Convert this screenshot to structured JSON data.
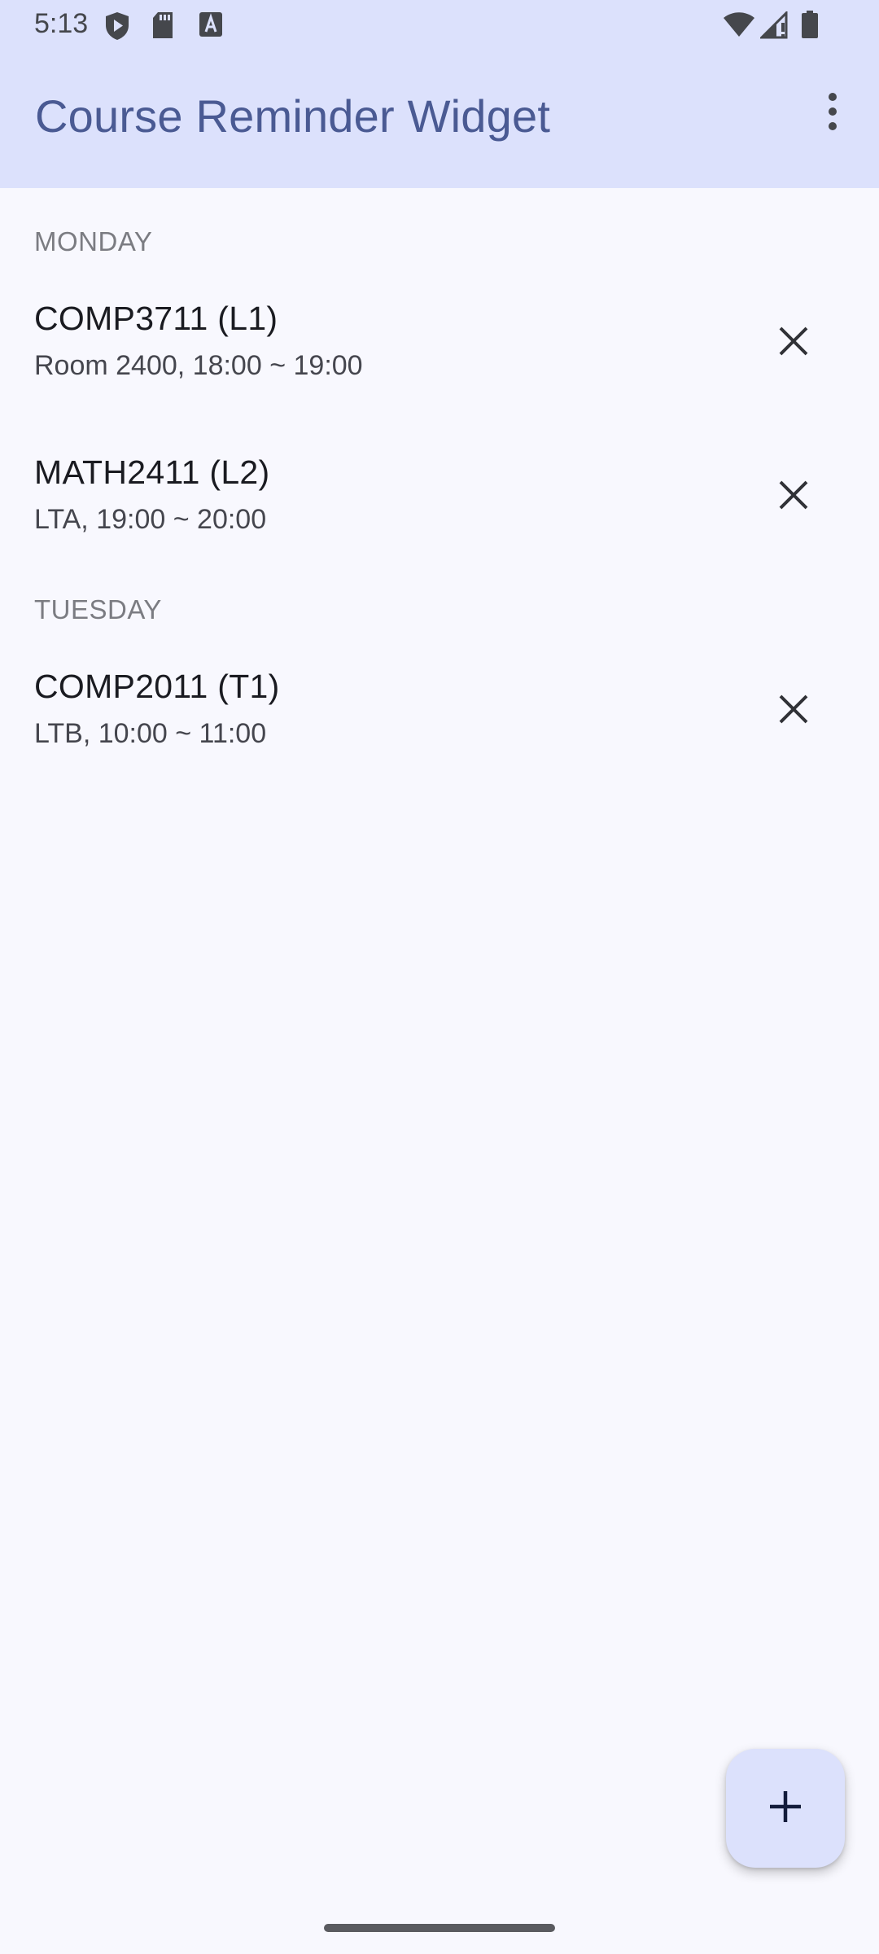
{
  "status_bar": {
    "time": "5:13",
    "left_icons": [
      "shield-play-icon",
      "sd-card-icon",
      "text-a-icon"
    ],
    "right_icons": [
      "wifi-icon",
      "signal-icon",
      "battery-icon"
    ]
  },
  "app_bar": {
    "title": "Course Reminder Widget",
    "menu_icon": "more-vert-icon"
  },
  "days": [
    {
      "label": "MONDAY",
      "courses": [
        {
          "title": "COMP3711 (L1)",
          "detail": "Room 2400, 18:00 ~ 19:00"
        },
        {
          "title": "MATH2411 (L2)",
          "detail": "LTA, 19:00 ~ 20:00"
        }
      ]
    },
    {
      "label": "TUESDAY",
      "courses": [
        {
          "title": "COMP2011 (T1)",
          "detail": "LTB, 10:00 ~ 11:00"
        }
      ]
    }
  ],
  "fab": {
    "icon": "plus-icon"
  },
  "colors": {
    "header_bg": "#dce1fc",
    "title": "#4a5a93",
    "background": "#f8f8fe",
    "section_label": "#7b7c82"
  }
}
